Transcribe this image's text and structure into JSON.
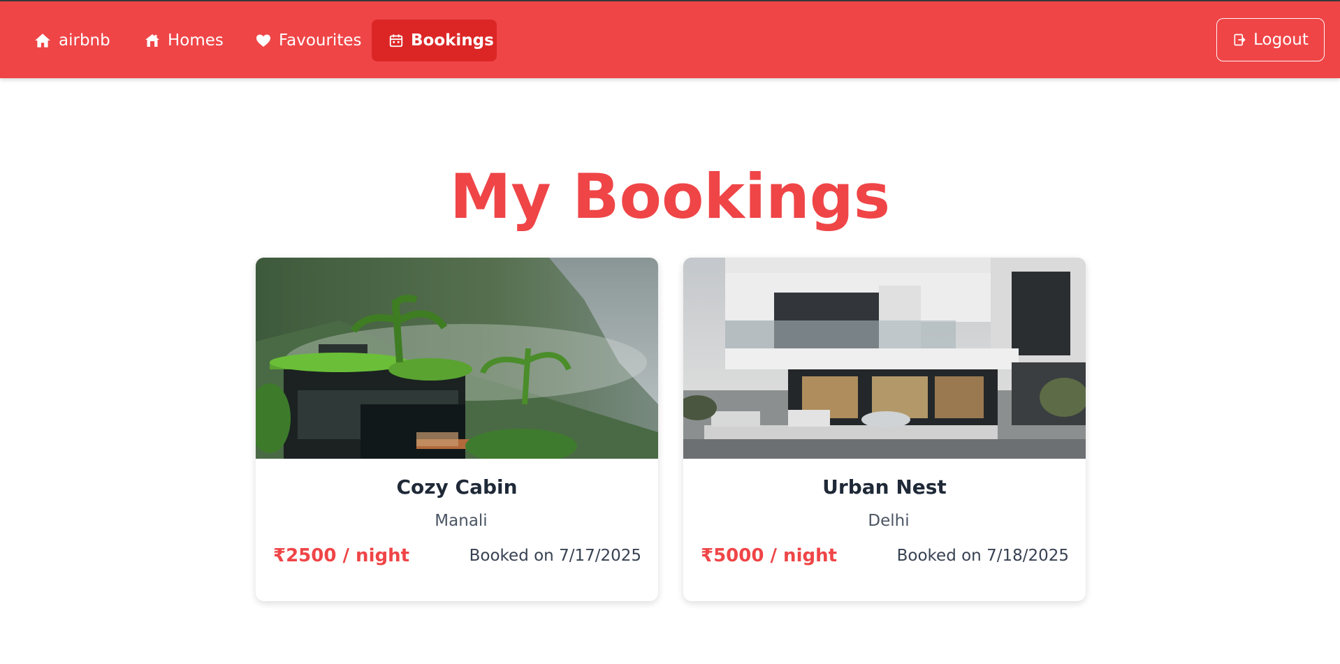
{
  "nav": {
    "brand_label": "airbnb",
    "homes_label": "Homes",
    "favourites_label": "Favourites",
    "bookings_label": "Bookings",
    "logout_label": "Logout",
    "active_item": "Bookings",
    "icons": {
      "brand": "house-icon",
      "homes": "homes-icon",
      "favourites": "heart-icon",
      "bookings": "calendar-icon",
      "logout": "logout-icon"
    }
  },
  "page": {
    "title": "My Bookings"
  },
  "bookings": [
    {
      "name": "Cozy Cabin",
      "location": "Manali",
      "price": "₹2500 / night",
      "booked_on": "Booked on 7/17/2025"
    },
    {
      "name": "Urban Nest",
      "location": "Delhi",
      "price": "₹5000 / night",
      "booked_on": "Booked on 7/18/2025"
    }
  ],
  "colors": {
    "brand": "#ef4547",
    "active_tab": "#dc2626",
    "heading": "#ef4547",
    "card_title": "#1f2937"
  }
}
